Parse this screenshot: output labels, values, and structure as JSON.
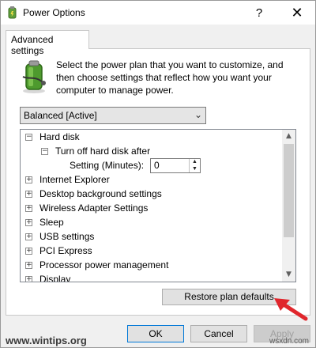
{
  "window": {
    "title": "Power Options",
    "help_label": "?",
    "close_label": "✕"
  },
  "tabs": [
    {
      "label": "Advanced settings"
    }
  ],
  "description": "Select the power plan that you want to customize, and then choose settings that reflect how you want your computer to manage power.",
  "plan_select": {
    "value": "Balanced [Active]"
  },
  "tree": {
    "items": [
      {
        "label": "Hard disk",
        "expander": "−"
      },
      {
        "label": "Turn off hard disk after",
        "expander": "−"
      },
      {
        "label": "Internet Explorer",
        "expander": "+"
      },
      {
        "label": "Desktop background settings",
        "expander": "+"
      },
      {
        "label": "Wireless Adapter Settings",
        "expander": "+"
      },
      {
        "label": "Sleep",
        "expander": "+"
      },
      {
        "label": "USB settings",
        "expander": "+"
      },
      {
        "label": "PCI Express",
        "expander": "+"
      },
      {
        "label": "Processor power management",
        "expander": "+"
      },
      {
        "label": "Display",
        "expander": "+"
      }
    ],
    "setting": {
      "label": "Setting (Minutes):",
      "value": "0"
    }
  },
  "buttons": {
    "restore": "Restore plan defaults",
    "ok": "OK",
    "cancel": "Cancel",
    "apply": "Apply"
  },
  "watermarks": {
    "left": "www.wintips.org",
    "right": "wsxdn.com"
  },
  "colors": {
    "accent": "#0078d7",
    "arrow": "#e0262c"
  }
}
